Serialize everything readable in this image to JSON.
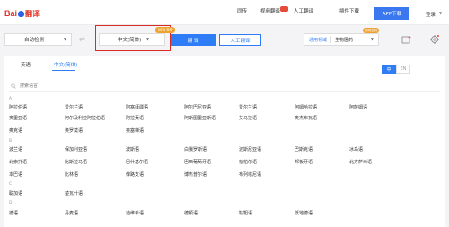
{
  "header": {
    "logo_text": "Bai",
    "logo_suffix": "翻译",
    "nav": [
      "同传",
      "视频翻译",
      "人工翻译",
      "插件下载"
    ],
    "app_button": "APP下载",
    "login": "登录"
  },
  "toolbar": {
    "source_lang": "自动检测",
    "target_lang": "中文(简体)",
    "target_badge": "NEW 免费",
    "translate_button": "翻 译",
    "human_button": "人工翻译",
    "domain_label": "通用领域",
    "domain_value": "生物医药",
    "domain_badge": "领域定制"
  },
  "panel": {
    "tabs": [
      "英语",
      "中文(简体)"
    ],
    "toggle": [
      "中",
      "EN"
    ],
    "search_placeholder": "搜索语言",
    "groups": [
      {
        "letter": "A",
        "rows": [
          [
            "阿拉伯语",
            "爱尔兰语",
            "阿塞拜疆语",
            "阿尔巴尼亚语",
            "爱尔兰语",
            "阿姆哈拉语",
            "阿萨姆语"
          ],
          [
            "奥里亚语",
            "阿尔及利亚阿拉伯语",
            "阿拉贡语",
            "阿斯图里亚斯语",
            "艾马拉语",
            "奥杰布瓦语"
          ],
          [
            "奥克语",
            "奥罗莫语",
            "奥塞梯语"
          ]
        ]
      },
      {
        "letter": "B",
        "rows": [
          [
            "波兰语",
            "保加利亚语",
            "波斯语",
            "白俄罗斯语",
            "波斯尼亚语",
            "巴斯克语",
            "冰岛语"
          ],
          [
            "北索托语",
            "比斯拉马语",
            "巴什基尔语",
            "巴西葡萄牙语",
            "柏柏尔语",
            "邦板牙语",
            "北方萨米语"
          ],
          [
            "本巴语",
            "比林语",
            "俾路支语",
            "博杰普尔语",
            "布列塔尼语"
          ]
        ]
      },
      {
        "letter": "C",
        "rows": [
          [
            "聪加语",
            "楚瓦什语"
          ]
        ]
      },
      {
        "letter": "D",
        "rows": [
          [
            "德语",
            "丹麦语",
            "迪维希语",
            "德顿语",
            "鞑靼语",
            "低地德语"
          ]
        ]
      }
    ]
  }
}
